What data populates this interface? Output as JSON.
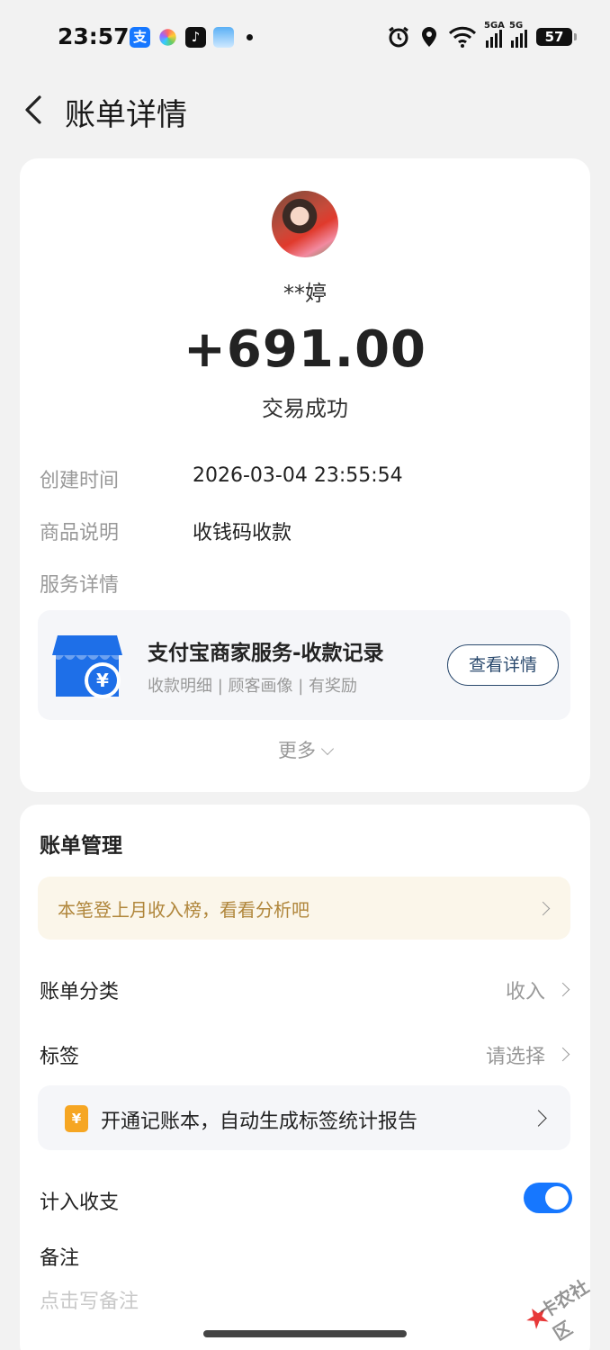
{
  "status_bar": {
    "time": "23:57",
    "battery": "57",
    "signal1": "5GA",
    "signal2": "5G"
  },
  "header": {
    "title": "账单详情"
  },
  "transaction": {
    "payer": "**婷",
    "amount": "+691.00",
    "status": "交易成功"
  },
  "details": {
    "created_label": "创建时间",
    "created_value": "2026-03-04 23:55:54",
    "goods_label": "商品说明",
    "goods_value": "收钱码收款",
    "service_label": "服务详情"
  },
  "service": {
    "title": "支付宝商家服务-收款记录",
    "subtitle": "收款明细 | 顾客画像 | 有奖励",
    "button": "查看详情",
    "more": "更多"
  },
  "bill_management": {
    "title": "账单管理",
    "tip": "本笔登上月收入榜，看看分析吧",
    "category_label": "账单分类",
    "category_value": "收入",
    "tag_label": "标签",
    "tag_value": "请选择",
    "promo_icon": "¥",
    "promo_text": "开通记账本，自动生成标签统计报告",
    "include_label": "计入收支",
    "include_enabled": true,
    "note_label": "备注",
    "note_placeholder": "点击写备注"
  },
  "watermark": {
    "text": "卡农社区"
  },
  "colors": {
    "accent": "#1677ff",
    "tip_text": "#b0863b",
    "background": "#f2f2f2"
  }
}
